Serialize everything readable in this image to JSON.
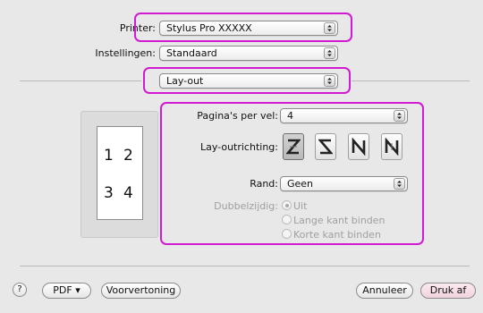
{
  "printer": {
    "label": "Printer:",
    "value": "Stylus Pro XXXXX"
  },
  "presets": {
    "label": "Instellingen:",
    "value": "Standaard"
  },
  "panel": {
    "value": "Lay-out"
  },
  "layout": {
    "pages_per_sheet": {
      "label": "Pagina's per vel:",
      "value": "4"
    },
    "direction": {
      "label": "Lay-outrichting:",
      "options": [
        "Z",
        "S",
        "N-mirror",
        "N"
      ],
      "selected_index": 0
    },
    "border": {
      "label": "Rand:",
      "value": "Geen"
    },
    "two_sided": {
      "label": "Dubbelzijdig:",
      "options": [
        "Uit",
        "Lange kant binden",
        "Korte kant binden"
      ],
      "selected_index": 0,
      "enabled": false
    }
  },
  "preview": {
    "page_numbers": [
      "1",
      "2",
      "3",
      "4"
    ]
  },
  "footer": {
    "help": "?",
    "pdf": "PDF ▾",
    "preview": "Voorvertoning",
    "cancel": "Annuleer",
    "print": "Druk af"
  },
  "colors": {
    "highlight": "#d21ad2"
  }
}
